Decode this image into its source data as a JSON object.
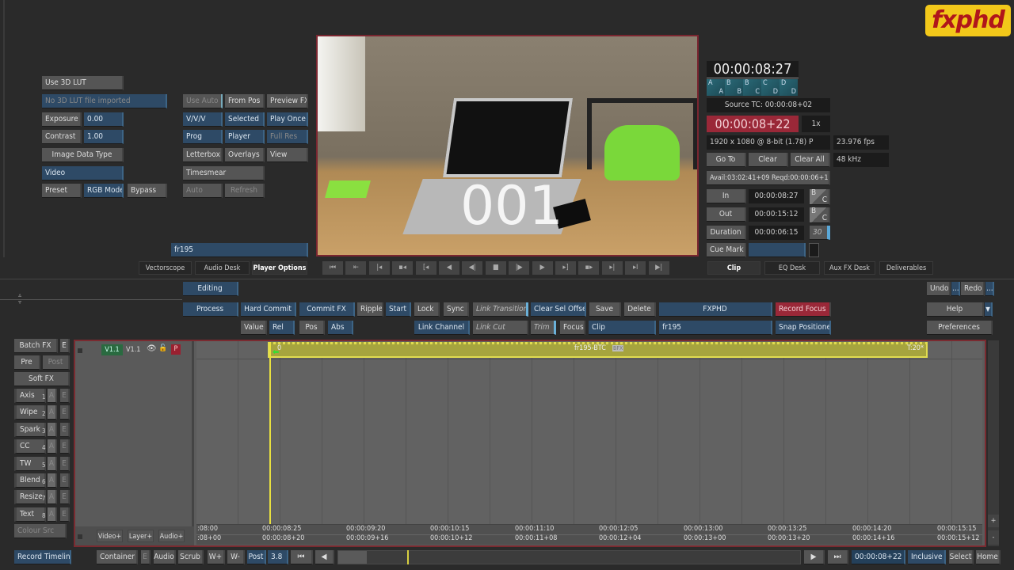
{
  "logo": "fxphd",
  "lut": {
    "use": "Use 3D LUT",
    "file": "No 3D LUT file imported",
    "exposure_label": "Exposure",
    "exposure": "0.00",
    "contrast_label": "Contrast",
    "contrast": "1.00",
    "image_data_type": "Image Data Type",
    "video": "Video",
    "preset": "Preset",
    "rgb_mode": "RGB Mode",
    "bypass": "Bypass"
  },
  "opts": {
    "use_auto": "Use Auto",
    "from_pos": "From Pos",
    "preview_fx": "Preview FX",
    "vvv": "V/V/V",
    "selected": "Selected",
    "play_once": "Play Once",
    "prog": "Prog",
    "player": "Player",
    "full_res": "Full Res",
    "letterbox": "Letterbox",
    "overlays": "Overlays",
    "view": "View",
    "timesmear": "Timesmear",
    "auto": "Auto",
    "refresh": "Refresh",
    "clip_name": "fr195"
  },
  "viewer": {
    "overlay": "001"
  },
  "tabs_left": [
    "Vectorscope",
    "Audio Desk",
    "Player Options"
  ],
  "tabs_right": [
    "Clip",
    "EQ Desk",
    "Aux FX Desk",
    "Deliverables"
  ],
  "transport": [
    "⏮",
    "⇤",
    "|◂",
    "▪◂",
    "[◂",
    "◀",
    "◀|",
    "■",
    "|▶",
    "▶",
    "▸]",
    "▪▸",
    "▸|",
    "▸I",
    "▶|"
  ],
  "info": {
    "tc": "00:00:08:27",
    "abcd": [
      [
        "A",
        "A"
      ],
      [
        "B",
        "B"
      ],
      [
        "B",
        "C"
      ],
      [
        "C",
        "D"
      ],
      [
        "D",
        "D"
      ]
    ],
    "source_tc": "Source TC: 00:00:08+02",
    "record_tc": "00:00:08+22",
    "speed": "1x",
    "format": "1920 x 1080 @ 8-bit (1.78) P",
    "fps": "23.976 fps",
    "goto": "Go To",
    "clear": "Clear",
    "clear_all": "Clear All",
    "audio_rate": "48 kHz",
    "avail": "Avail:03:02:41+09 Reqd:00:00:06+11",
    "in_label": "In",
    "in_tc": "00:00:08:27",
    "out_label": "Out",
    "out_tc": "00:00:15:12",
    "duration_label": "Duration",
    "duration_tc": "00:00:06:15",
    "duration_val": "30",
    "bc": [
      "B",
      "C"
    ],
    "cue_mark": "Cue Mark"
  },
  "edit": {
    "editing": "Editing",
    "process": "Process",
    "hard_commit": "Hard Commit",
    "commit_fx": "Commit FX",
    "ripple": "Ripple",
    "start": "Start",
    "lock": "Lock",
    "sync": "Sync",
    "link_transition": "Link Transition",
    "clear_sel_offset": "Clear Sel Offset",
    "save": "Save",
    "delete": "Delete",
    "fxphd": "FXPHD",
    "record_focus": "Record Focus",
    "help": "Help",
    "value": "Value",
    "rel": "Rel",
    "pos": "Pos",
    "abs": "Abs",
    "link_channel": "Link Channel",
    "link_cut": "Link Cut",
    "trim": "Trim",
    "focus": "Focus",
    "clip": "Clip",
    "clip_name": "fr195",
    "snap_positioner": "Snap Positioner",
    "preferences": "Preferences",
    "undo": "Undo",
    "redo": "Redo",
    "more": "..."
  },
  "fx": {
    "batch_fx": "Batch FX",
    "e": "E",
    "pre": "Pre",
    "post": "Post",
    "soft_fx": "Soft FX",
    "items": [
      {
        "l": "Axis",
        "n": "1",
        "a": "A"
      },
      {
        "l": "Wipe",
        "n": "2",
        "a": "A"
      },
      {
        "l": "Spark",
        "n": "3",
        "a": "A"
      },
      {
        "l": "CC",
        "n": "4",
        "a": "A"
      },
      {
        "l": "TW",
        "n": "5",
        "a": "A"
      },
      {
        "l": "Blend",
        "n": "6",
        "a": "A"
      },
      {
        "l": "Resize",
        "n": "7",
        "a": "A"
      },
      {
        "l": "Text",
        "n": "8",
        "a": "A"
      }
    ],
    "colour_src": "Colour Src",
    "record_timeline": "Record Timeline"
  },
  "timeline": {
    "track_src": "V1.1",
    "track_dst": "V1.1",
    "priority": "P",
    "video_add": "Video+",
    "layer_add": "Layer+",
    "audio_add": "Audio+",
    "clip_label": "fr195-BTC",
    "clip_badge": "BFX",
    "clip_start": "0",
    "clip_end": "T:20*",
    "ruler_top": [
      ":08:00",
      "00:00:08:25",
      "00:00:09:20",
      "00:00:10:15",
      "00:00:11:10",
      "00:00:12:05",
      "00:00:13:00",
      "00:00:13:25",
      "00:00:14:20",
      "00:00:15:15"
    ],
    "ruler_bottom": [
      ":08+00",
      "00:00:08+20",
      "00:00:09+16",
      "00:00:10+12",
      "00:00:11+08",
      "00:00:12+04",
      "00:00:13+00",
      "00:00:13+20",
      "00:00:14+16",
      "00:00:15+12"
    ],
    "plus": "+",
    "minus": "-"
  },
  "bottom": {
    "container": "Container",
    "e": "E",
    "audio": "Audio",
    "scrub": "Scrub",
    "wplus": "W+",
    "wminus": "W-",
    "post": "Post",
    "zoom": "3.8",
    "first": "⏮",
    "prev": "◀",
    "next": "▶",
    "last": "⏭",
    "tc": "00:00:08+22",
    "inclusive": "Inclusive",
    "select": "Select",
    "home": "Home"
  },
  "colors": {
    "accent_blue": "#2e4a66",
    "record_red": "#9a2838",
    "clip_olive": "#a8a640",
    "playhead": "#e8e040",
    "logo_yellow": "#f2c81a"
  }
}
